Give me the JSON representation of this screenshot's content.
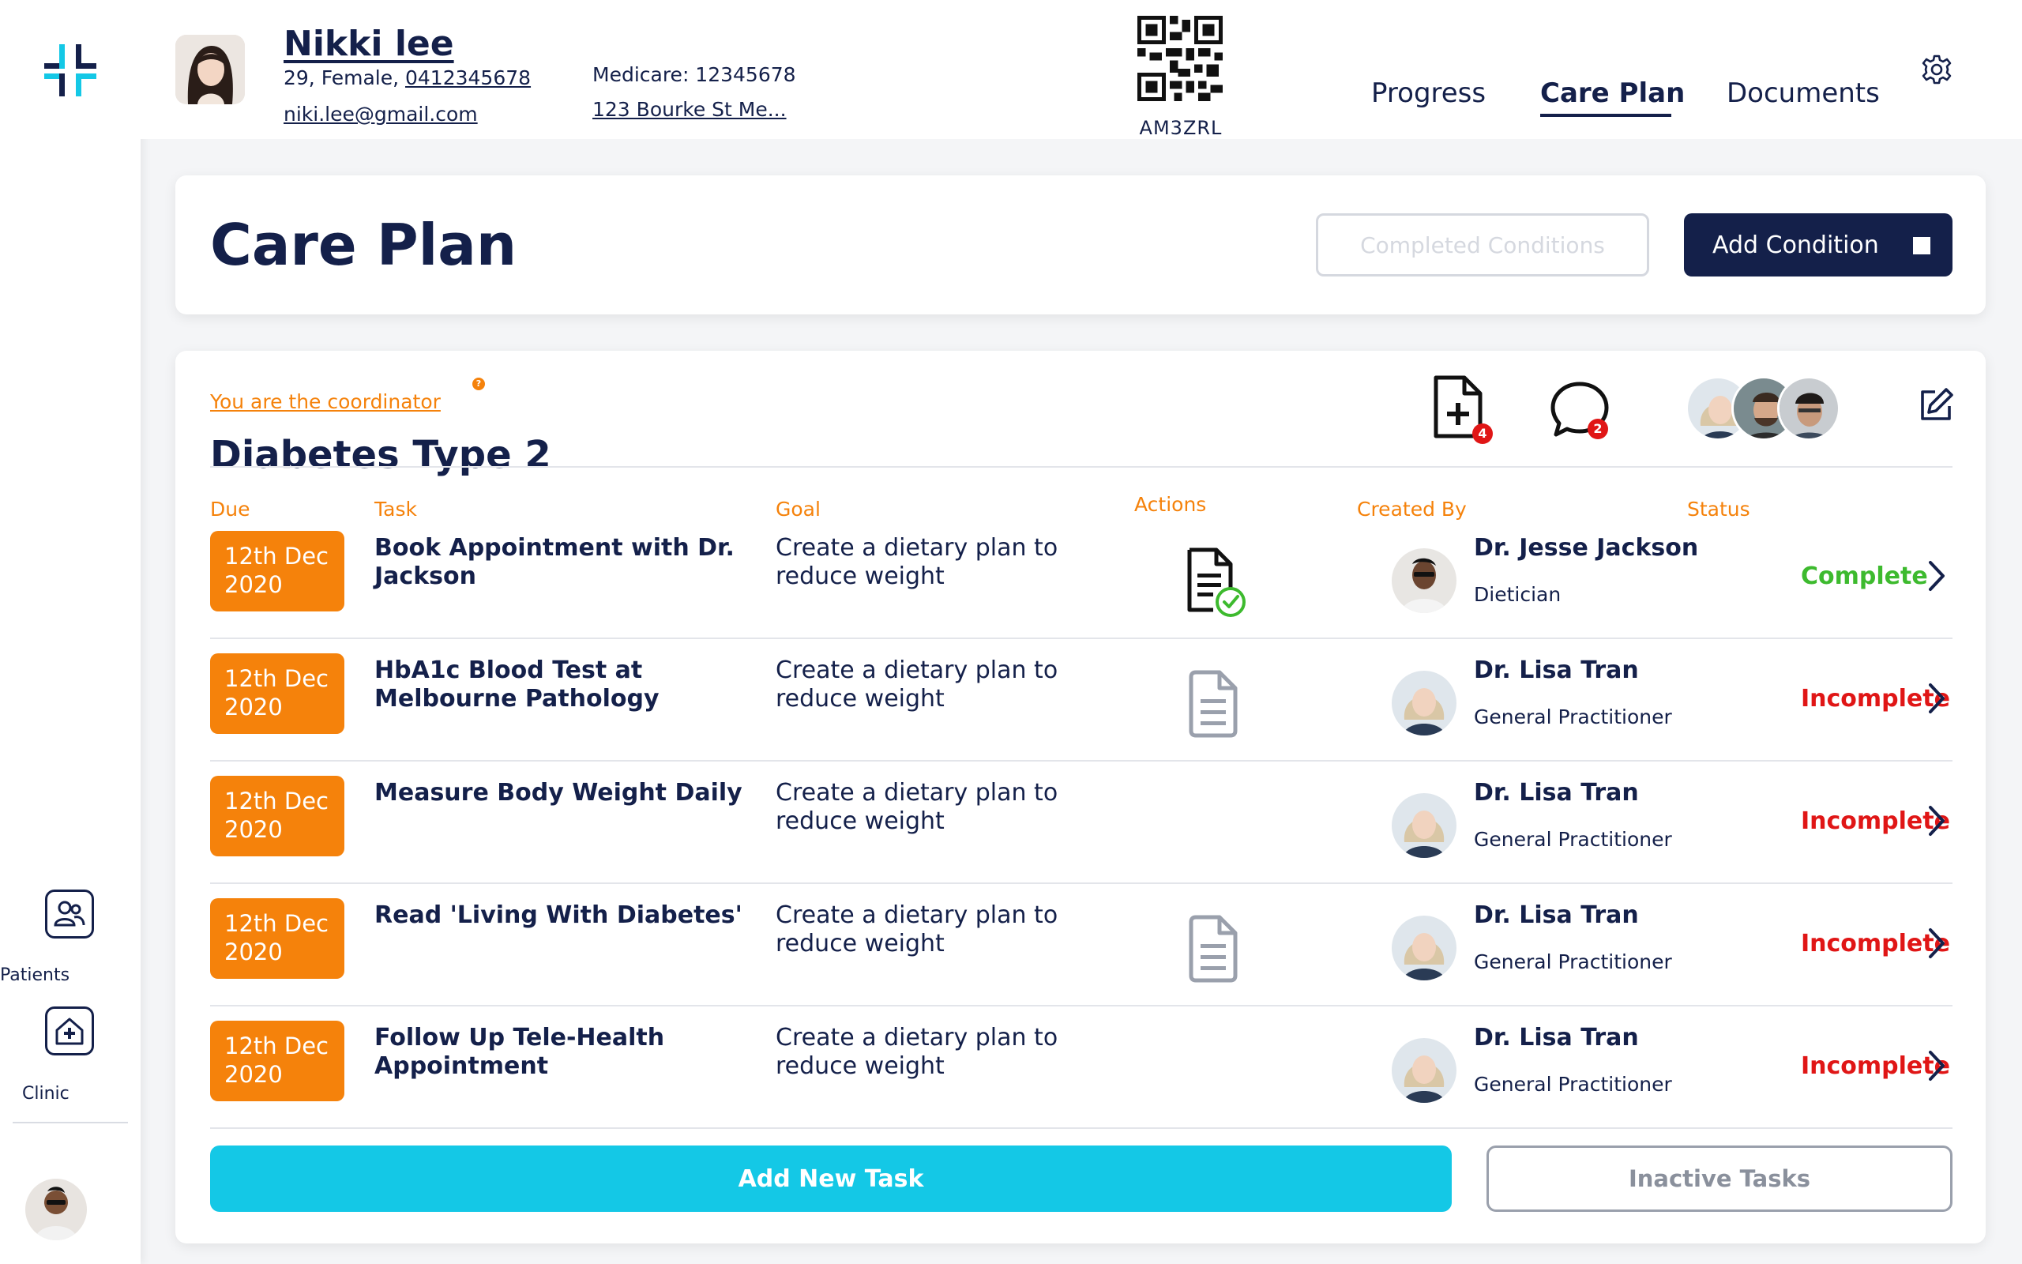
{
  "patient": {
    "name": "Nikki lee",
    "age_gender": "29, Female, ",
    "phone": "0412345678",
    "email": "niki.lee@gmail.com",
    "medicare": "Medicare: 12345678",
    "address": "123 Bourke St Me...",
    "qr_code_label": "AM3ZRL"
  },
  "tabs": [
    {
      "label": "Progress"
    },
    {
      "label": "Care Plan",
      "active": true
    },
    {
      "label": "Documents"
    }
  ],
  "sidebar": {
    "items": [
      {
        "label": "Patients",
        "icon": "patients-icon"
      },
      {
        "label": "Clinic",
        "icon": "clinic-icon"
      }
    ]
  },
  "title_card": {
    "title": "Care Plan",
    "completed_conditions_label": "Completed Conditions",
    "add_condition_label": "Add Condition"
  },
  "condition": {
    "coordinator_text": "You are the coordinator",
    "help_mark": "?",
    "title": "Diabetes Type 2",
    "documents_badge": "4",
    "messages_badge": "2"
  },
  "columns": {
    "due": "Due",
    "task": "Task",
    "goal": "Goal",
    "actions": "Actions",
    "created_by": "Created By",
    "status": "Status"
  },
  "tasks": [
    {
      "due_line1": "12th Dec",
      "due_line2": "2020",
      "task": "Book Appointment with Dr. Jackson",
      "goal": "Create a dietary plan to reduce weight",
      "action": "document-check",
      "creator": "Dr. Jesse Jackson",
      "role": "Dietician",
      "status": "Complete"
    },
    {
      "due_line1": "12th Dec",
      "due_line2": "2020",
      "task": "HbA1c Blood Test at Melbourne Pathology",
      "goal": "Create a dietary plan to reduce weight",
      "action": "document",
      "creator": "Dr. Lisa Tran",
      "role": "General Practitioner",
      "status": "Incomplete"
    },
    {
      "due_line1": "12th Dec",
      "due_line2": "2020",
      "task": "Measure Body Weight Daily",
      "goal": "Create a dietary plan to reduce weight",
      "action": "none",
      "creator": "Dr. Lisa Tran",
      "role": "General Practitioner",
      "status": "Incomplete"
    },
    {
      "due_line1": "12th Dec",
      "due_line2": "2020",
      "task": "Read 'Living With Diabetes'",
      "goal": "Create a dietary plan to reduce weight",
      "action": "document",
      "creator": "Dr. Lisa Tran",
      "role": "General Practitioner",
      "status": "Incomplete"
    },
    {
      "due_line1": "12th Dec",
      "due_line2": "2020",
      "task": "Follow Up Tele-Health Appointment",
      "goal": "Create a dietary plan to reduce weight",
      "action": "none",
      "creator": "Dr. Lisa Tran",
      "role": "General Practitioner",
      "status": "Incomplete"
    }
  ],
  "footer": {
    "add_task_label": "Add New Task",
    "inactive_tasks_label": "Inactive Tasks"
  },
  "colors": {
    "navy": "#14204a",
    "orange": "#f5820b",
    "complete_green": "#3dba2e",
    "incomplete_red": "#e01616",
    "cyan": "#14c8e6"
  }
}
